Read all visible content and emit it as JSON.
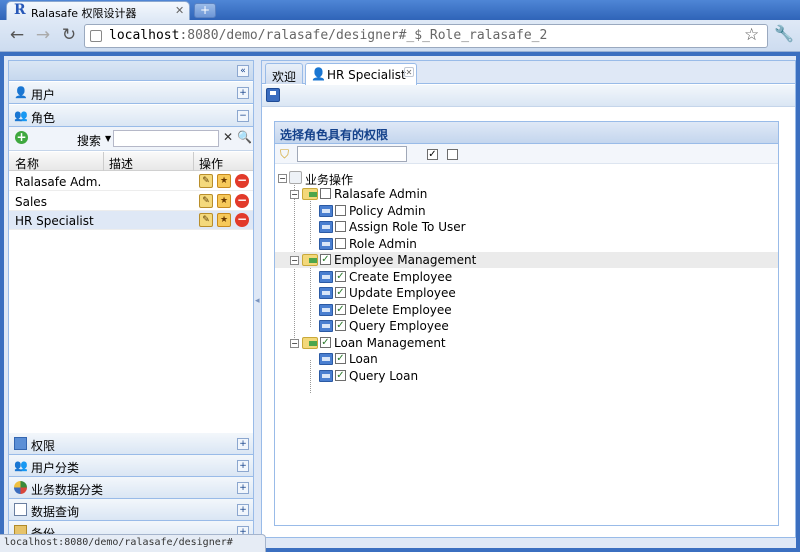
{
  "browser": {
    "tab_title": "Ralasafe 权限设计器",
    "tab_logo": "R",
    "url_host": "localhost",
    "url_rest": ":8080/demo/ralasafe/designer#_$_Role_ralasafe_2",
    "status_text": "localhost:8080/demo/ralasafe/designer#"
  },
  "left_panel": {
    "accordion_top": [
      {
        "label": "用户",
        "tool": "+"
      },
      {
        "label": "角色",
        "tool": "−"
      }
    ],
    "search_label": "搜索",
    "grid_columns": [
      "名称",
      "描述",
      "操作"
    ],
    "roles": [
      {
        "name": "Ralasafe Adm...",
        "selected": false
      },
      {
        "name": "Sales",
        "selected": false
      },
      {
        "name": "HR Specialist",
        "selected": true
      }
    ],
    "accordion_bottom": [
      {
        "label": "权限",
        "tool": "+"
      },
      {
        "label": "用户分类",
        "tool": "+"
      },
      {
        "label": "业务数据分类",
        "tool": "+"
      },
      {
        "label": "数据查询",
        "tool": "+"
      },
      {
        "label": "备份",
        "tool": "+"
      }
    ]
  },
  "right_panel": {
    "tabs": [
      {
        "label": "欢迎",
        "active": false
      },
      {
        "label": "HR Specialist",
        "active": true
      }
    ],
    "permission_panel_title": "选择角色具有的权限",
    "tree": [
      {
        "label": "业务操作",
        "level": 0,
        "kind": "root",
        "checked": null
      },
      {
        "label": "Ralasafe Admin",
        "level": 1,
        "kind": "folder",
        "checked": false
      },
      {
        "label": "Policy Admin",
        "level": 2,
        "kind": "leaf",
        "checked": false
      },
      {
        "label": "Assign Role To User",
        "level": 2,
        "kind": "leaf",
        "checked": false
      },
      {
        "label": "Role Admin",
        "level": 2,
        "kind": "leaf",
        "checked": false
      },
      {
        "label": "Employee Management",
        "level": 1,
        "kind": "folder",
        "checked": true
      },
      {
        "label": "Create Employee",
        "level": 2,
        "kind": "leaf",
        "checked": true
      },
      {
        "label": "Update Employee",
        "level": 2,
        "kind": "leaf",
        "checked": true
      },
      {
        "label": "Delete Employee",
        "level": 2,
        "kind": "leaf",
        "checked": true
      },
      {
        "label": "Query Employee",
        "level": 2,
        "kind": "leaf",
        "checked": true
      },
      {
        "label": "Loan Management",
        "level": 1,
        "kind": "folder",
        "checked": true
      },
      {
        "label": "Loan",
        "level": 2,
        "kind": "leaf",
        "checked": true
      },
      {
        "label": "Query Loan",
        "level": 2,
        "kind": "leaf",
        "checked": true
      }
    ]
  }
}
